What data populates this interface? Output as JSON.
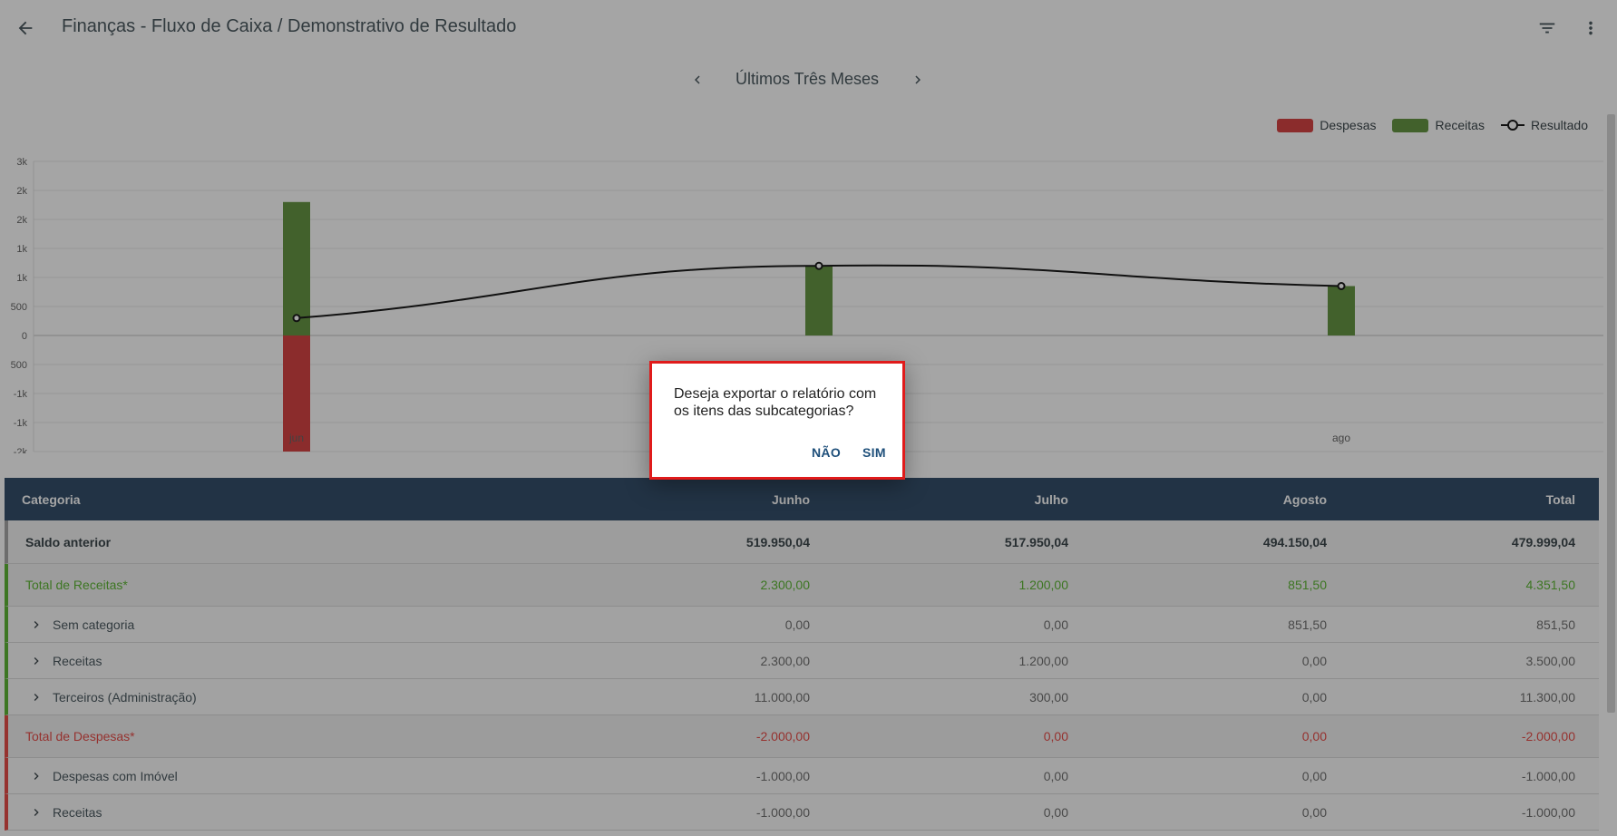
{
  "header": {
    "title": "Finanças - Fluxo de Caixa / Demonstrativo de Resultado"
  },
  "period": {
    "label": "Últimos Três Meses"
  },
  "legend": {
    "despesas": "Despesas",
    "receitas": "Receitas",
    "resultado": "Resultado",
    "despesas_color": "#d32f2f",
    "receitas_color": "#558b2f",
    "resultado_color": "#000000"
  },
  "chart_data": {
    "type": "bar",
    "categories": [
      "jun",
      "jul",
      "ago"
    ],
    "series": [
      {
        "name": "Despesas",
        "values": [
          -2000,
          0,
          0
        ],
        "color": "#d32f2f"
      },
      {
        "name": "Receitas",
        "values": [
          2300,
          1200,
          851.5
        ],
        "color": "#558b2f"
      },
      {
        "name": "Resultado",
        "type": "line",
        "values": [
          300,
          1200,
          851.5
        ],
        "color": "#000000"
      }
    ],
    "yticks": [
      3000,
      2500,
      2000,
      1500,
      1000,
      500,
      0,
      -500,
      -1000,
      -1500,
      -2000
    ],
    "ytick_labels": [
      "3k",
      "2k",
      "2k",
      "1k",
      "1k",
      "500",
      "0",
      "500",
      "-1k",
      "-1k",
      "-2k"
    ],
    "xtick_labels": [
      "jun",
      "",
      "ago"
    ],
    "ylim": [
      -2000,
      2500
    ],
    "grid": true,
    "legend_position": "top-right"
  },
  "table": {
    "headers": [
      "Categoria",
      "Junho",
      "Julho",
      "Agosto",
      "Total"
    ],
    "saldo": {
      "label": "Saldo anterior",
      "values": [
        "519.950,04",
        "517.950,04",
        "494.150,04",
        "479.999,04"
      ]
    },
    "total_receitas": {
      "label": "Total de Receitas*",
      "values": [
        "2.300,00",
        "1.200,00",
        "851,50",
        "4.351,50"
      ]
    },
    "receitas_rows": [
      {
        "label": "Sem categoria",
        "values": [
          "0,00",
          "0,00",
          "851,50",
          "851,50"
        ]
      },
      {
        "label": "Receitas",
        "values": [
          "2.300,00",
          "1.200,00",
          "0,00",
          "3.500,00"
        ]
      },
      {
        "label": "Terceiros (Administração)",
        "values": [
          "11.000,00",
          "300,00",
          "0,00",
          "11.300,00"
        ]
      }
    ],
    "total_despesas": {
      "label": "Total de Despesas*",
      "values": [
        "-2.000,00",
        "0,00",
        "0,00",
        "-2.000,00"
      ]
    },
    "despesas_rows": [
      {
        "label": "Despesas com Imóvel",
        "values": [
          "-1.000,00",
          "0,00",
          "0,00",
          "-1.000,00"
        ]
      },
      {
        "label": "Receitas",
        "values": [
          "-1.000,00",
          "0,00",
          "0,00",
          "-1.000,00"
        ]
      }
    ]
  },
  "dialog": {
    "message": "Deseja exportar o relatório com os itens das subcategorias?",
    "no_label": "NÃO",
    "yes_label": "SIM"
  },
  "icons": {
    "back": "arrow-left-icon",
    "filter": "filter-icon",
    "more": "more-vert-icon",
    "prev": "chevron-left-icon",
    "next": "chevron-right-icon",
    "expand": "chevron-right-icon"
  }
}
